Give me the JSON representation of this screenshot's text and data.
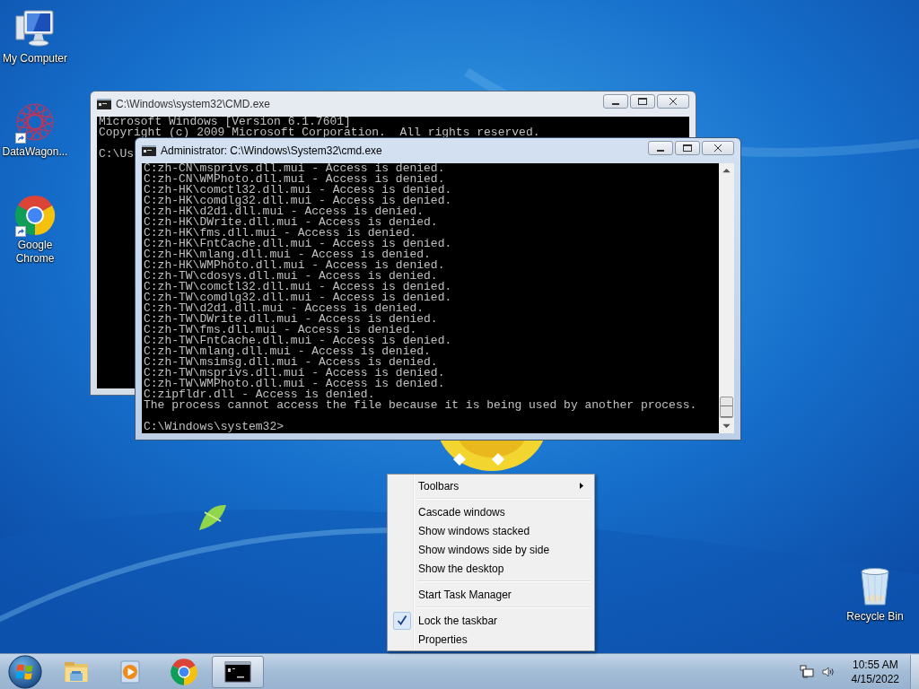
{
  "desktop_icons": [
    {
      "label": "My Computer",
      "kind": "computer",
      "shortcut": false
    },
    {
      "label": "DataWagon...",
      "kind": "starburst",
      "shortcut": true
    },
    {
      "label": "Google Chrome",
      "kind": "browser",
      "shortcut": true
    }
  ],
  "recycle_bin": {
    "label": "Recycle Bin"
  },
  "windows": [
    {
      "title": "C:\\Windows\\system32\\CMD.exe",
      "active": false,
      "lines": [
        "Microsoft Windows [Version 6.1.7601]",
        "Copyright (c) 2009 Microsoft Corporation.  All rights reserved."
      ],
      "prompt": "C:\\Us"
    },
    {
      "title": "Administrator: C:\\Windows\\System32\\cmd.exe",
      "active": true,
      "lines": [
        "C:zh-CN\\msprivs.dll.mui - Access is denied.",
        "C:zh-CN\\WMPhoto.dll.mui - Access is denied.",
        "C:zh-HK\\comctl32.dll.mui - Access is denied.",
        "C:zh-HK\\comdlg32.dll.mui - Access is denied.",
        "C:zh-HK\\d2d1.dll.mui - Access is denied.",
        "C:zh-HK\\DWrite.dll.mui - Access is denied.",
        "C:zh-HK\\fms.dll.mui - Access is denied.",
        "C:zh-HK\\FntCache.dll.mui - Access is denied.",
        "C:zh-HK\\mlang.dll.mui - Access is denied.",
        "C:zh-HK\\WMPhoto.dll.mui - Access is denied.",
        "C:zh-TW\\cdosys.dll.mui - Access is denied.",
        "C:zh-TW\\comctl32.dll.mui - Access is denied.",
        "C:zh-TW\\comdlg32.dll.mui - Access is denied.",
        "C:zh-TW\\d2d1.dll.mui - Access is denied.",
        "C:zh-TW\\DWrite.dll.mui - Access is denied.",
        "C:zh-TW\\fms.dll.mui - Access is denied.",
        "C:zh-TW\\FntCache.dll.mui - Access is denied.",
        "C:zh-TW\\mlang.dll.mui - Access is denied.",
        "C:zh-TW\\msimsg.dll.mui - Access is denied.",
        "C:zh-TW\\msprivs.dll.mui - Access is denied.",
        "C:zh-TW\\WMPhoto.dll.mui - Access is denied.",
        "C:zipfldr.dll - Access is denied.",
        "The process cannot access the file because it is being used by another process."
      ],
      "prompt": "C:\\Windows\\system32>"
    }
  ],
  "context_menu": {
    "groups": [
      [
        {
          "label": "Toolbars",
          "submenu": true,
          "checked": false
        }
      ],
      [
        {
          "label": "Cascade windows",
          "submenu": false,
          "checked": false
        },
        {
          "label": "Show windows stacked",
          "submenu": false,
          "checked": false
        },
        {
          "label": "Show windows side by side",
          "submenu": false,
          "checked": false
        },
        {
          "label": "Show the desktop",
          "submenu": false,
          "checked": false
        }
      ],
      [
        {
          "label": "Start Task Manager",
          "submenu": false,
          "checked": false
        }
      ],
      [
        {
          "label": "Lock the taskbar",
          "submenu": false,
          "checked": true
        },
        {
          "label": "Properties",
          "submenu": false,
          "checked": false
        }
      ]
    ]
  },
  "taskbar": {
    "items": [
      {
        "kind": "folder",
        "active": false
      },
      {
        "kind": "media",
        "active": false
      },
      {
        "kind": "browser",
        "active": false
      },
      {
        "kind": "console",
        "active": true
      }
    ],
    "clock": {
      "time": "10:55 AM",
      "date": "4/15/2022"
    }
  }
}
